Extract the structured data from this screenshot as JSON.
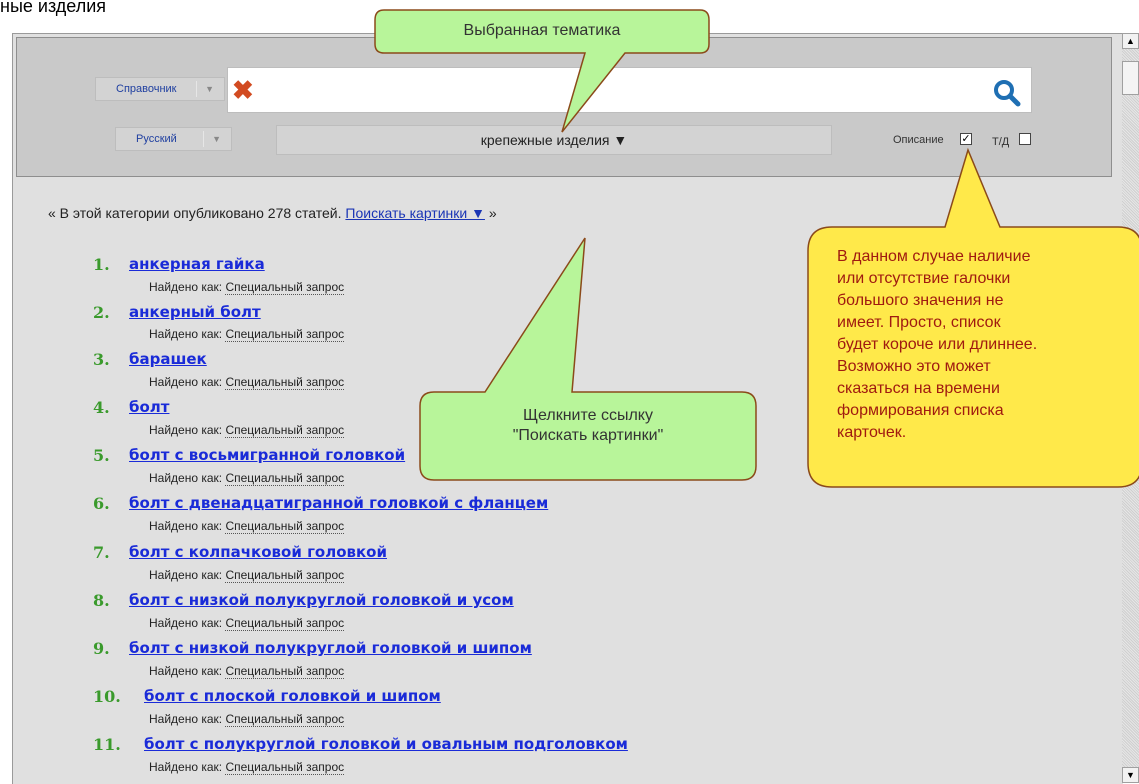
{
  "page": {
    "title_fragment": "ные изделия",
    "dictionary_dropdown": "Справочник",
    "language_dropdown": "Русский",
    "topic": "крепежные изделия",
    "topic_arrow": "▼",
    "option_description": "Описание",
    "option_description_checked": true,
    "option_td": "Т/Д",
    "option_td_checked": false,
    "summary_prefix": "« В этой категории опубликовано 278 статей.",
    "summary_link": "Поискать картинки ▼",
    "summary_suffix": "»"
  },
  "results": [
    {
      "num": "1.",
      "title": "анкерная гайка",
      "found_label": "Найдено как:",
      "found_value": "Специальный запрос"
    },
    {
      "num": "2.",
      "title": "анкерный болт",
      "found_label": "Найдено как:",
      "found_value": "Специальный запрос"
    },
    {
      "num": "3.",
      "title": "барашек",
      "found_label": "Найдено как:",
      "found_value": "Специальный запрос"
    },
    {
      "num": "4.",
      "title": "болт",
      "found_label": "Найдено как:",
      "found_value": "Специальный запрос"
    },
    {
      "num": "5.",
      "title": "болт с восьмигранной головкой",
      "found_label": "Найдено как:",
      "found_value": "Специальный запрос"
    },
    {
      "num": "6.",
      "title": "болт с двенадцатигранной головкой с фланцем",
      "found_label": "Найдено как:",
      "found_value": "Специальный запрос"
    },
    {
      "num": "7.",
      "title": "болт с колпачковой головкой",
      "found_label": "Найдено как:",
      "found_value": "Специальный запрос"
    },
    {
      "num": "8.",
      "title": "болт с низкой полукруглой головкой и усом",
      "found_label": "Найдено как:",
      "found_value": "Специальный запрос"
    },
    {
      "num": "9.",
      "title": "болт с низкой полукруглой головкой и шипом",
      "found_label": "Найдено как:",
      "found_value": "Специальный запрос"
    },
    {
      "num": "10.",
      "title": "болт с плоской головкой и шипом",
      "found_label": "Найдено как:",
      "found_value": "Специальный запрос"
    },
    {
      "num": "11.",
      "title": "болт с полукруглой головкой и овальным подголовком",
      "found_label": "Найдено как:",
      "found_value": "Специальный запрос"
    }
  ],
  "callouts": {
    "selected_topic": "Выбранная тематика",
    "click_link_line1": "Щелкните ссылку",
    "click_link_line2": "\"Поискать картинки\"",
    "note_lines": [
      "В данном случае наличие",
      "или отсутствие галочки",
      "большого значения не",
      "имеет. Просто, список",
      "будет короче или длиннее.",
      "Возможно это может",
      "сказаться на времени",
      "формирования списка",
      "карточек."
    ]
  },
  "colors": {
    "link": "#1a2bd8",
    "number": "#3a9a2c",
    "callout_green": "#b8f59a",
    "callout_yellow": "#ffe94a",
    "callout_border": "#8b4a1a"
  },
  "icons": {
    "clear": "red-x-icon",
    "search": "magnifier-icon"
  }
}
